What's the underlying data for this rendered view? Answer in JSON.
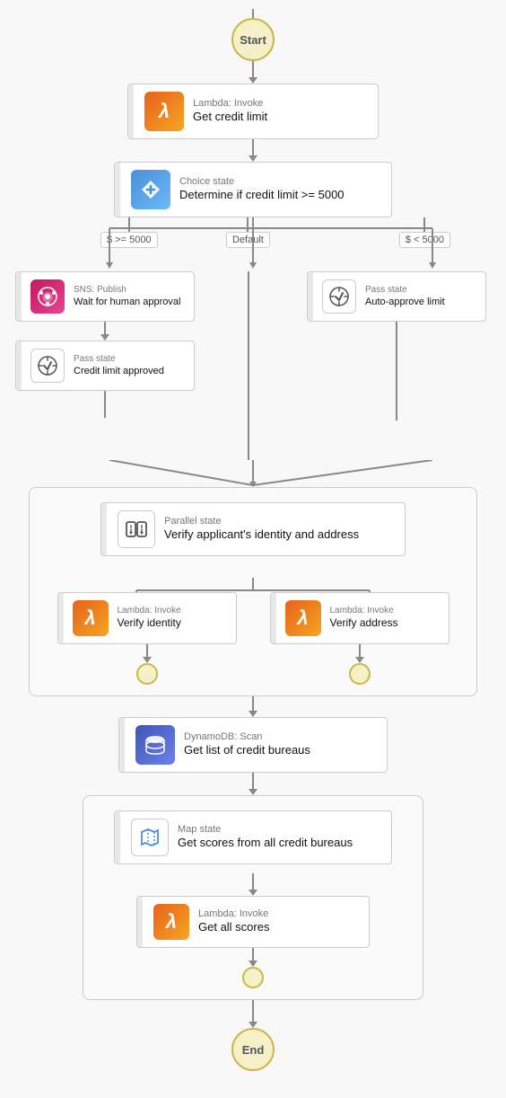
{
  "nodes": {
    "start": "Start",
    "end": "End",
    "lambda1": {
      "title": "Lambda: Invoke",
      "label": "Get credit limit"
    },
    "choice1": {
      "title": "Choice state",
      "label": "Determine if credit limit >= 5000"
    },
    "branch_left_label": "$ >= 5000",
    "branch_default_label": "Default",
    "branch_right_label": "$ < 5000",
    "sns1": {
      "title": "SNS: Publish",
      "label": "Wait for human approval"
    },
    "pass1": {
      "title": "Pass state",
      "label": "Credit limit approved"
    },
    "pass2": {
      "title": "Pass state",
      "label": "Auto-approve limit"
    },
    "parallel1": {
      "title": "Parallel state",
      "label": "Verify applicant's identity and address"
    },
    "lambda2": {
      "title": "Lambda: Invoke",
      "label": "Verify identity"
    },
    "lambda3": {
      "title": "Lambda: Invoke",
      "label": "Verify address"
    },
    "dynamo1": {
      "title": "DynamoDB: Scan",
      "label": "Get list of credit bureaus"
    },
    "map1": {
      "title": "Map state",
      "label": "Get scores from all credit bureaus"
    },
    "lambda4": {
      "title": "Lambda: Invoke",
      "label": "Get all scores"
    }
  }
}
